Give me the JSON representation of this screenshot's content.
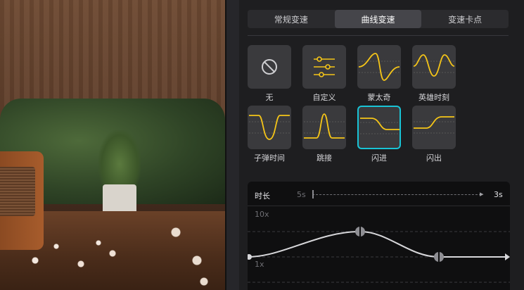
{
  "tabs": [
    {
      "label": "常规变速"
    },
    {
      "label": "曲线变速"
    },
    {
      "label": "变速卡点"
    }
  ],
  "active_tab": "曲线变速",
  "presets": [
    {
      "label": "无",
      "icon": "none-icon"
    },
    {
      "label": "自定义",
      "icon": "sliders-icon"
    },
    {
      "label": "蒙太奇",
      "icon": "montage-curve-icon"
    },
    {
      "label": "英雄时刻",
      "icon": "hero-moment-curve-icon"
    },
    {
      "label": "子弹时间",
      "icon": "bullet-time-curve-icon"
    },
    {
      "label": "跳接",
      "icon": "jump-cut-curve-icon"
    },
    {
      "label": "闪进",
      "icon": "flash-in-curve-icon"
    },
    {
      "label": "闪出",
      "icon": "flash-out-curve-icon"
    }
  ],
  "selected_preset": "闪进",
  "duration": {
    "label": "时长",
    "min_label": "5s",
    "value": "3s"
  },
  "graph": {
    "y_top_label": "10x",
    "y_bottom_label": "1x"
  },
  "colors": {
    "accent": "#19c4d6",
    "curve_icon": "#f5c518",
    "active_tab_bg": "#45454a"
  }
}
